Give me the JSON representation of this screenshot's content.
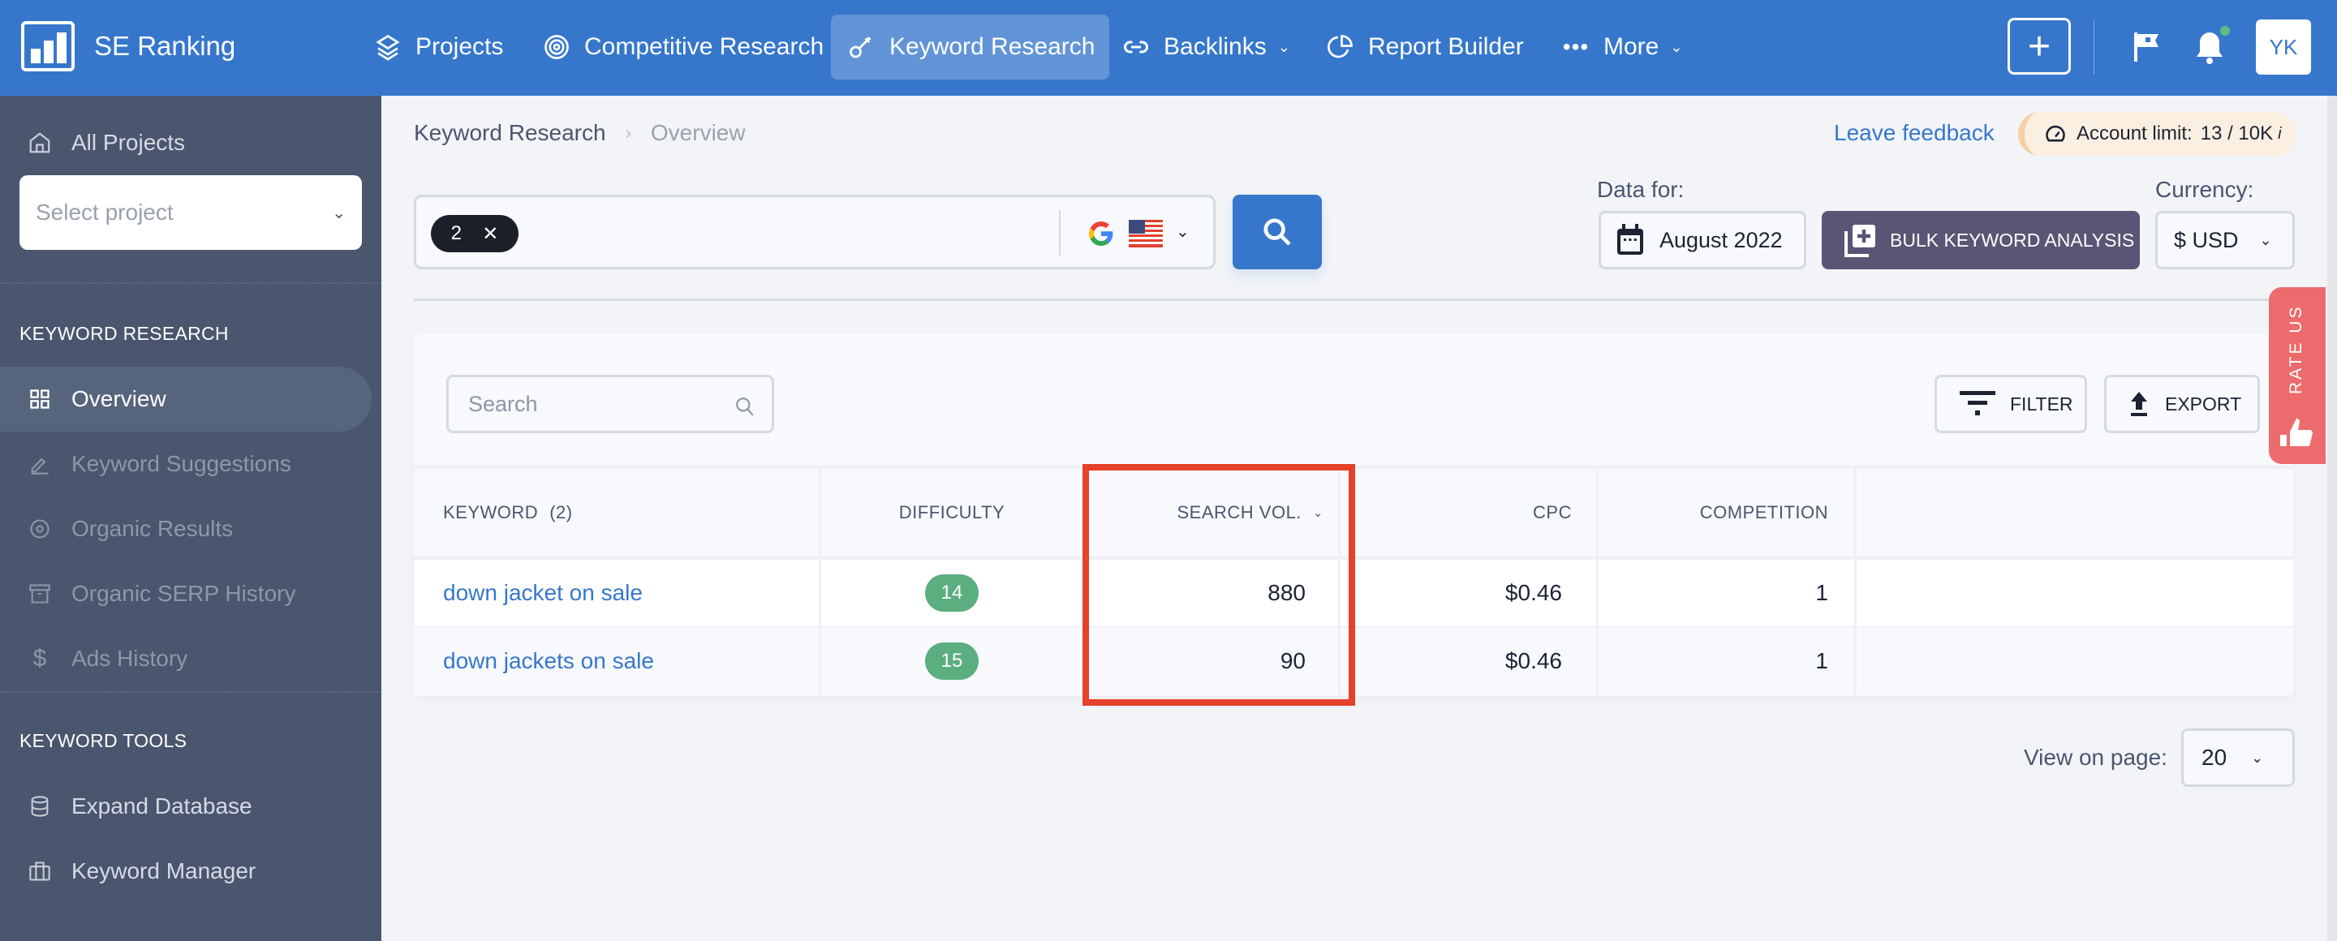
{
  "topnav": {
    "brand": "SE Ranking",
    "items": [
      {
        "label": "Projects",
        "icon": "layers-icon"
      },
      {
        "label": "Competitive Research",
        "icon": "target-icon"
      },
      {
        "label": "Keyword Research",
        "icon": "key-icon",
        "active": true
      },
      {
        "label": "Backlinks",
        "icon": "link-icon",
        "dropdown": true
      },
      {
        "label": "Report Builder",
        "icon": "pie-chart-icon"
      },
      {
        "label": "More",
        "icon": "more-dots-icon",
        "dropdown": true
      }
    ],
    "add_label": "+",
    "avatar_initials": "YK"
  },
  "sidebar": {
    "all_projects": "All Projects",
    "select_project_placeholder": "Select project",
    "section_keyword_research": "KEYWORD RESEARCH",
    "keyword_research_items": [
      {
        "label": "Overview",
        "icon": "grid-icon",
        "active": true
      },
      {
        "label": "Keyword Suggestions",
        "icon": "pencil-icon"
      },
      {
        "label": "Organic Results",
        "icon": "target-icon"
      },
      {
        "label": "Organic SERP History",
        "icon": "archive-icon"
      },
      {
        "label": "Ads History",
        "icon": "dollar-icon"
      }
    ],
    "section_keyword_tools": "KEYWORD TOOLS",
    "keyword_tools_items": [
      {
        "label": "Expand Database",
        "icon": "database-icon"
      },
      {
        "label": "Keyword Manager",
        "icon": "briefcase-icon"
      }
    ]
  },
  "breadcrumb": {
    "parent": "Keyword Research",
    "separator": "›",
    "current": "Overview"
  },
  "feedback_link": "Leave feedback",
  "account_limit": {
    "label": "Account limit:",
    "value": "13 / 10K",
    "info": "i"
  },
  "keyword_input": {
    "chip_count": "2",
    "chip_remove": "✕",
    "search_engine": "Google",
    "country": "United States"
  },
  "data_for": {
    "label": "Data for:",
    "value": "August 2022"
  },
  "bulk_button": "BULK KEYWORD ANALYSIS",
  "currency": {
    "label": "Currency:",
    "value": "$ USD"
  },
  "rate_us": "RATE US",
  "table": {
    "search_placeholder": "Search",
    "filter_label": "FILTER",
    "export_label": "EXPORT",
    "columns": {
      "keyword": "KEYWORD",
      "keyword_count": "(2)",
      "difficulty": "DIFFICULTY",
      "search_vol": "SEARCH VOL.",
      "cpc": "CPC",
      "competition": "COMPETITION"
    },
    "rows": [
      {
        "keyword": "down jacket on sale",
        "difficulty": "14",
        "search_vol": "880",
        "cpc": "$0.46",
        "competition": "1"
      },
      {
        "keyword": "down jackets on sale",
        "difficulty": "15",
        "search_vol": "90",
        "cpc": "$0.46",
        "competition": "1"
      }
    ],
    "highlighted_column": "search_vol"
  },
  "pagination": {
    "label": "View on page:",
    "value": "20"
  },
  "colors": {
    "nav_blue": "#3677cc",
    "sidebar": "#4a566e",
    "difficulty_badge": "#5aae80",
    "bulk_button": "#5a5575",
    "rate_us": "#ec6b6d",
    "highlight": "#e6412a"
  }
}
